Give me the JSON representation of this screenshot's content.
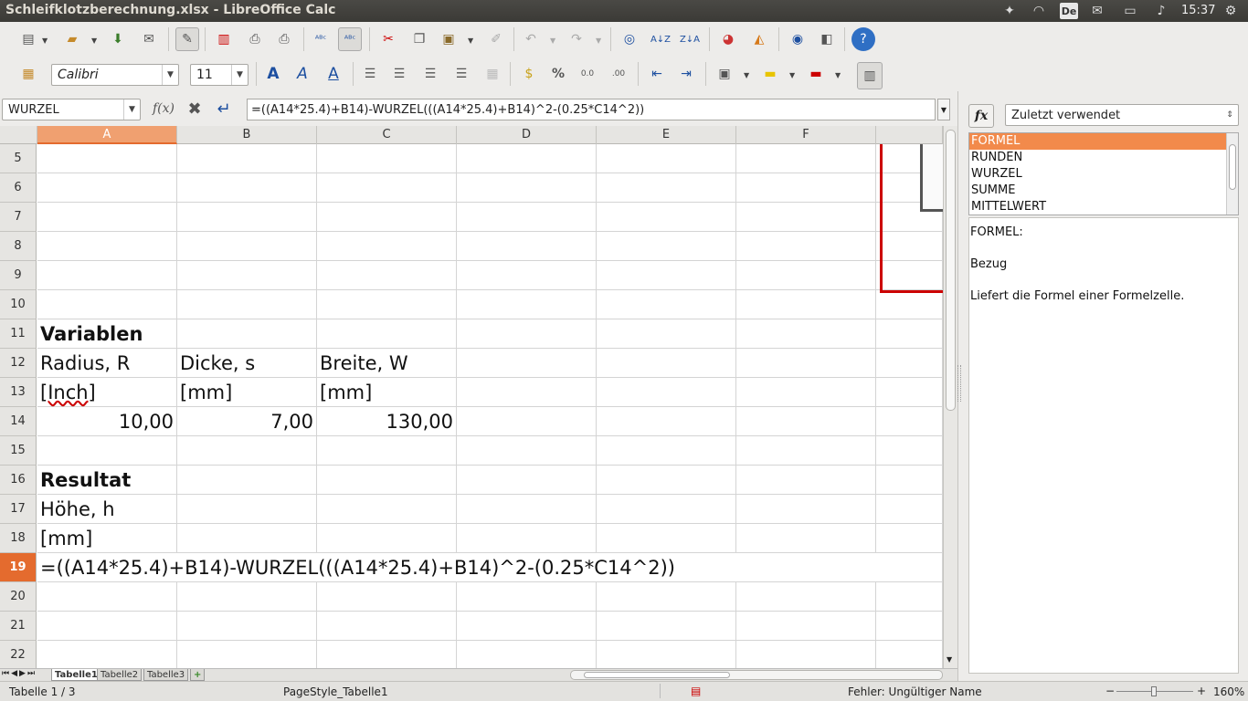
{
  "window": {
    "title": "Schleifklotzberechnung.xlsx - LibreOffice Calc"
  },
  "tray": {
    "language": "De",
    "clock": "15:37"
  },
  "toolbar2": {
    "font_name": "Calibri",
    "font_size": "11"
  },
  "formula_bar": {
    "name_box": "WURZEL",
    "formula": "=((A14*25.4)+B14)-WURZEL(((A14*25.4)+B14)^2-(0.25*C14^2))"
  },
  "columns": [
    "A",
    "B",
    "C",
    "D",
    "E",
    "F"
  ],
  "rows": [
    "5",
    "6",
    "7",
    "8",
    "9",
    "10",
    "11",
    "12",
    "13",
    "14",
    "15",
    "16",
    "17",
    "18",
    "19",
    "20",
    "21",
    "22"
  ],
  "cells": {
    "r11_a": "Variablen",
    "r12_a": "Radius, R",
    "r12_b": "Dicke, s",
    "r12_c": "Breite, W",
    "r13_a": "[Inch]",
    "r13_b": "[mm]",
    "r13_c": "[mm]",
    "r14_a": "10,00",
    "r14_b": "7,00",
    "r14_c": "130,00",
    "r16_a": "Resultat",
    "r17_a": "Höhe, h",
    "r18_a": "[mm]",
    "r19_a": "=((A14*25.4)+B14)-WURZEL(((A14*25.4)+B14)^2-(0.25*C14^2))"
  },
  "sheet_tabs": [
    "Tabelle1",
    "Tabelle2",
    "Tabelle3"
  ],
  "status": {
    "sheet": "Tabelle 1 / 3",
    "page_style": "PageStyle_Tabelle1",
    "error": "Fehler: Ungültiger Name",
    "zoom": "160%"
  },
  "sidebar": {
    "category": "Zuletzt verwendet",
    "functions": [
      "FORMEL",
      "RUNDEN",
      "WURZEL",
      "SUMME",
      "MITTELWERT"
    ],
    "desc_title": "FORMEL:",
    "desc_param": "Bezug",
    "desc_text": "Liefert die Formel einer Formelzelle."
  },
  "colors": {
    "accent": "#e46b2e",
    "selection": "#f28a4b",
    "border_red": "#cc0000"
  }
}
